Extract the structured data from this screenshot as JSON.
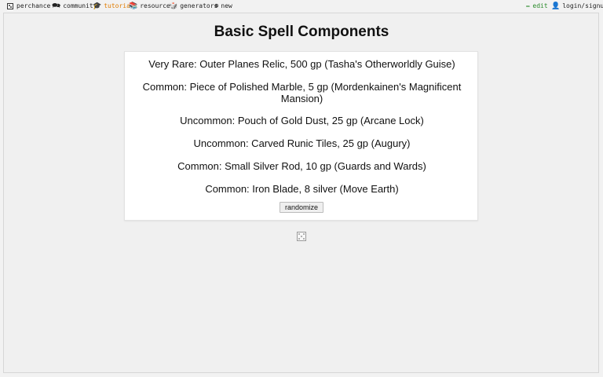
{
  "nav": {
    "perchance": "perchance",
    "community": "community",
    "tutorial": "tutorial",
    "resources": "resources",
    "generators": "generators",
    "new": "new",
    "edit": "edit",
    "login": "login/signup"
  },
  "icons": {
    "community": "🗪",
    "tutorial": "🎓",
    "resources": "📚",
    "generators": "🎲",
    "new": "⊕",
    "edit": "✏",
    "login": "👤"
  },
  "page": {
    "title": "Basic Spell Components",
    "items": [
      "Very Rare: Outer Planes Relic, 500 gp (Tasha's Otherworldly Guise)",
      "Common: Piece of Polished Marble, 5 gp (Mordenkainen's Magnificent Mansion)",
      "Uncommon: Pouch of Gold Dust, 25 gp (Arcane Lock)",
      "Uncommon: Carved Runic Tiles, 25 gp (Augury)",
      "Common: Small Silver Rod, 10 gp (Guards and Wards)",
      "Common: Iron Blade, 8 silver (Move Earth)"
    ],
    "button": "randomize"
  }
}
